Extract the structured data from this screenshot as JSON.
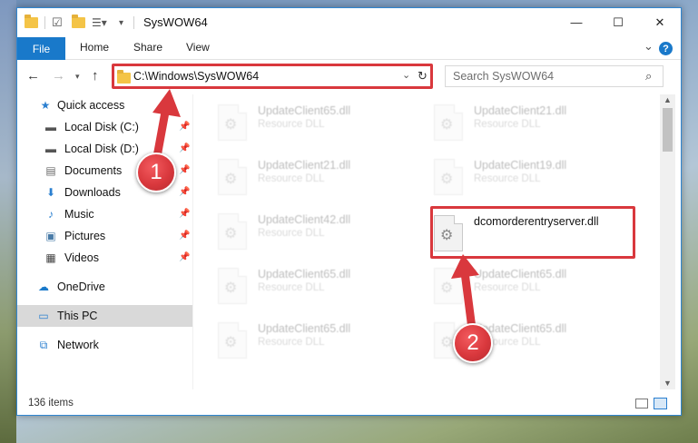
{
  "window": {
    "title": "SysWOW64",
    "minimize": "—",
    "maximize": "☐",
    "close": "✕"
  },
  "ribbon": {
    "tabs": [
      "File",
      "Home",
      "Share",
      "View"
    ],
    "expand": "⌄",
    "help": "?"
  },
  "address": {
    "path": "C:\\Windows\\SysWOW64",
    "search_placeholder": "Search SysWOW64"
  },
  "nav": {
    "items": [
      {
        "label": "Quick access",
        "icon": "star-icon",
        "pinned": false
      },
      {
        "label": "Local Disk (C:)",
        "icon": "drive-icon",
        "pinned": true
      },
      {
        "label": "Local Disk (D:)",
        "icon": "drive-icon",
        "pinned": true
      },
      {
        "label": "Documents",
        "icon": "documents-icon",
        "pinned": true
      },
      {
        "label": "Downloads",
        "icon": "download-icon",
        "pinned": true
      },
      {
        "label": "Music",
        "icon": "music-icon",
        "pinned": true
      },
      {
        "label": "Pictures",
        "icon": "pictures-icon",
        "pinned": true
      },
      {
        "label": "Videos",
        "icon": "videos-icon",
        "pinned": true
      },
      {
        "label": "OneDrive",
        "icon": "cloud-icon",
        "pinned": false
      },
      {
        "label": "This PC",
        "icon": "computer-icon",
        "pinned": false,
        "selected": true
      },
      {
        "label": "Network",
        "icon": "network-icon",
        "pinned": false
      }
    ]
  },
  "files": {
    "left": [
      {
        "name": "UpdateClient65.dll",
        "type": "Resource DLL"
      },
      {
        "name": "UpdateClient21.dll",
        "type": "Resource DLL"
      },
      {
        "name": "UpdateClient42.dll",
        "type": "Resource DLL"
      },
      {
        "name": "UpdateClient65.dll",
        "type": "Resource DLL"
      },
      {
        "name": "UpdateClient65.dll",
        "type": "Resource DLL"
      }
    ],
    "right": [
      {
        "name": "UpdateClient21.dll",
        "type": "Resource DLL"
      },
      {
        "name": "UpdateClient19.dll",
        "type": "Resource DLL"
      },
      {
        "name": "dcomorderentryserver.dll",
        "type": ""
      },
      {
        "name": "UpdateClient65.dll",
        "type": "Resource DLL"
      },
      {
        "name": "UpdateClient65.dll",
        "type": "Resource DLL"
      }
    ]
  },
  "status": {
    "count": "136 items"
  },
  "annotations": {
    "badge_1": "1",
    "badge_2": "2",
    "color": "#d9383d"
  }
}
